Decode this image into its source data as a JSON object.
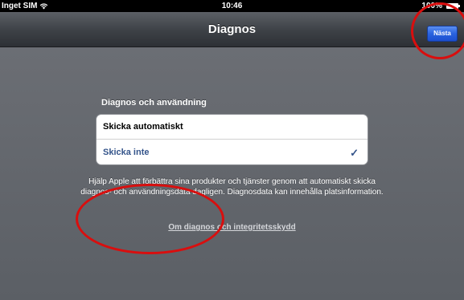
{
  "status_bar": {
    "carrier": "Inget SIM",
    "time": "10:46",
    "battery": "100%"
  },
  "nav_bar": {
    "title": "Diagnos",
    "next_label": "Nästa"
  },
  "section": {
    "header": "Diagnos och användning",
    "options": [
      {
        "label": "Skicka automatiskt",
        "selected": false
      },
      {
        "label": "Skicka inte",
        "selected": true
      }
    ],
    "checkmark": "✓"
  },
  "footer": {
    "text": "Hjälp Apple att förbättra sina produkter och tjänster genom att automatiskt skicka diagnos- och användningsdata dagligen. Diagnosdata kan innehålla platsinformation.",
    "privacy_link": "Om diagnos och integritetsskydd"
  },
  "colors": {
    "annotation": "#d90e0e",
    "accent_blue": "#2a63df",
    "selected_text": "#34548a"
  },
  "icons": [
    "wifi-icon",
    "battery-icon",
    "checkmark-icon"
  ]
}
